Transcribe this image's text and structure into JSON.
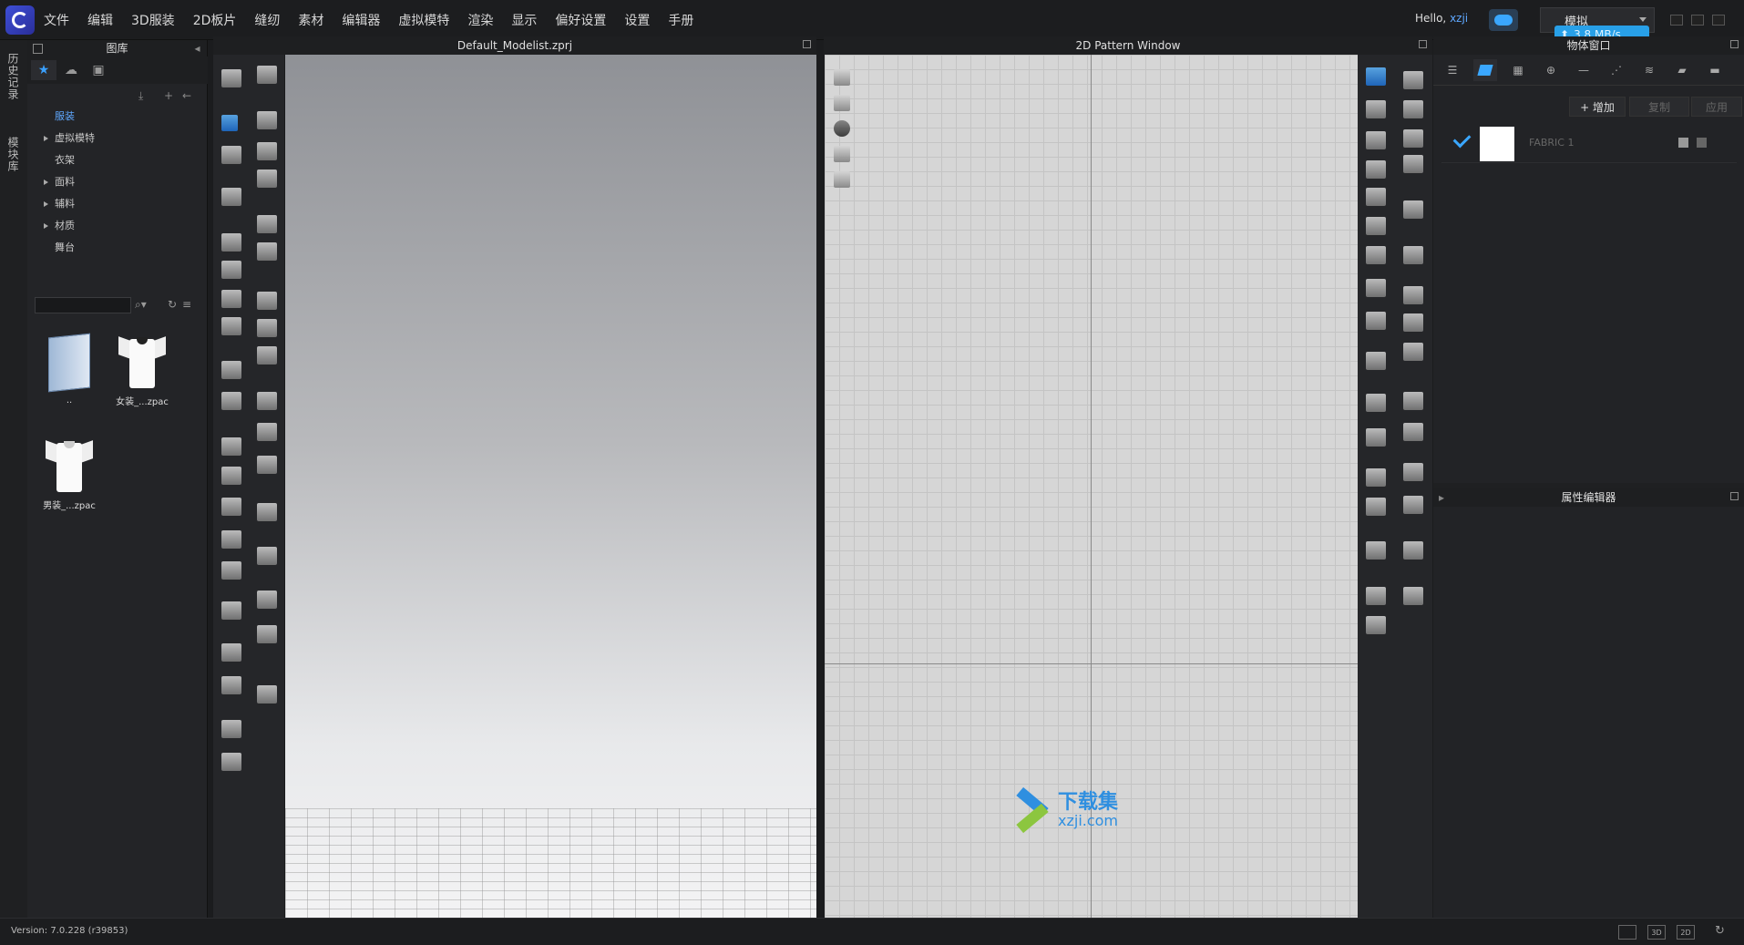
{
  "app": {
    "menu": [
      "文件",
      "编辑",
      "3D服装",
      "2D板片",
      "缝纫",
      "素材",
      "编辑器",
      "虚拟模特",
      "渲染",
      "显示",
      "偏好设置",
      "设置",
      "手册"
    ],
    "hello_prefix": "Hello,",
    "username": "xzji",
    "mode_label": "模拟",
    "speed": "3.8 MB/s",
    "accent_color": "#3aa7ff"
  },
  "left_strip": {
    "history": "历史记录",
    "modular": "模块库"
  },
  "library": {
    "title": "图库",
    "tree": [
      {
        "label": "服装",
        "expandable": false,
        "selected": true
      },
      {
        "label": "虚拟模特",
        "expandable": true,
        "selected": false
      },
      {
        "label": "衣架",
        "expandable": false,
        "selected": false
      },
      {
        "label": "面料",
        "expandable": true,
        "selected": false
      },
      {
        "label": "辅料",
        "expandable": true,
        "selected": false
      },
      {
        "label": "材质",
        "expandable": true,
        "selected": false
      },
      {
        "label": "舞台",
        "expandable": false,
        "selected": false
      }
    ],
    "search_placeholder": "",
    "items": [
      {
        "label": "..",
        "icon": "folder-icon"
      },
      {
        "label": "女装_...zpac",
        "icon": "tshirt-icon"
      },
      {
        "label": "男装_...zpac",
        "icon": "tshirt-icon"
      }
    ]
  },
  "view3d": {
    "title": "Default_Modelist.zprj"
  },
  "view2d": {
    "title": "2D Pattern Window"
  },
  "watermark": {
    "brand": "下载集",
    "domain": "xzji.com"
  },
  "object_browser": {
    "title": "物体窗口",
    "add_label": "+ 增加",
    "copy_label": "复制",
    "apply_label": "应用",
    "fabric_name": "FABRIC 1"
  },
  "property_editor": {
    "title": "属性编辑器"
  },
  "status": {
    "version": "Version: 7.0.228 (r39853)",
    "btn_3d": "3D",
    "btn_2d": "2D"
  }
}
